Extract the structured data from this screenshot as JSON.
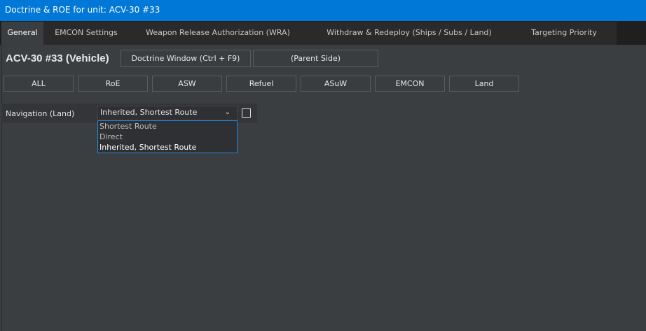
{
  "window": {
    "title": "Doctrine & ROE for unit: ACV-30 #33"
  },
  "tabs": [
    "General",
    "EMCON Settings",
    "Weapon Release Authorization (WRA)",
    "Withdraw & Redeploy (Ships / Subs / Land)",
    "Targeting Priority"
  ],
  "unit_name": "ACV-30 #33 (Vehicle)",
  "buttons": {
    "doctrine_window": "Doctrine Window (Ctrl + F9)",
    "parent_side": "(Parent Side)"
  },
  "filters": [
    "ALL",
    "RoE",
    "ASW",
    "Refuel",
    "ASuW",
    "EMCON",
    "Land"
  ],
  "navigation": {
    "label": "Navigation (Land)",
    "value": "Inherited, Shortest Route",
    "options": [
      "Shortest Route",
      "Direct",
      "Inherited, Shortest Route"
    ],
    "checked": false
  }
}
